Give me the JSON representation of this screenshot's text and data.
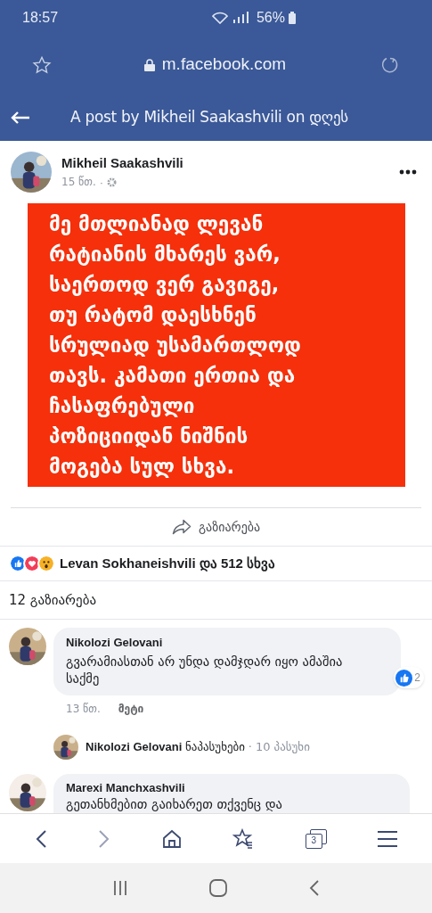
{
  "status_bar": {
    "time": "18:57",
    "battery": "56%"
  },
  "browser": {
    "url": "m.facebook.com",
    "tab_count": "3"
  },
  "header": {
    "title": "A post by Mikheil Saakashvili on დღეს"
  },
  "post": {
    "author": "Mikheil Saakashvili",
    "time": "15 წთ.",
    "text": "მე მთლიანად ლევან\nრატიანის მხარეს ვარ,\nსაერთოდ ვერ გავიგე,\nთუ რატომ დაესხნენ\nსრულიად უსამართლოდ\nთავს. კამათი ერთია და\nჩასაფრებული\nპოზიციიდან ნიშნის\nმოგება სულ სხვა.",
    "share_label": "გაზიარება",
    "separator": "·",
    "reactions": [
      {
        "kind": "like"
      },
      {
        "kind": "love"
      },
      {
        "kind": "wow"
      }
    ],
    "reactions_text": "Levan Sokhaneishvili და 512 სხვა",
    "shares_count": "12 გაზიარება"
  },
  "comments": [
    {
      "author": "Nikolozi Gelovani",
      "text": "გვარამიასთან არ უნდა დამჯდარ იყო ამაშია საქმე",
      "like_count": "2",
      "time": "13 წთ.",
      "more": "მეტი",
      "reply": {
        "author": "Nikolozi Gelovani",
        "action": "ნაპასუხები",
        "separator": "·",
        "count": "10 პასუხი"
      }
    },
    {
      "author": "Marexi Manchxashvili",
      "text": "გეთანხმებით გაიხარეთ თქვენც და"
    }
  ]
}
